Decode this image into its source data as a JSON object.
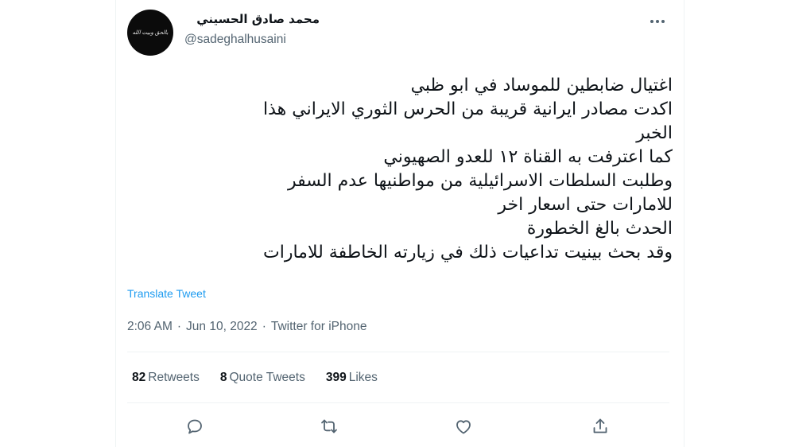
{
  "author": {
    "display_name": "محمد صادق الحسيني",
    "handle": "@sadeghalhusaini",
    "avatar_text": "بالحق وبيت الله"
  },
  "tweet": {
    "lines": [
      "اغتيال ضابطين للموساد في ابو ظبي",
      "اكدت مصادر ايرانية قريبة من الحرس الثوري الايراني هذا",
      "الخبر",
      "كما اعترفت به القناة ١٢ للعدو الصهيوني",
      "وطلبت السلطات الاسرائيلية من مواطنيها عدم السفر",
      "للامارات حتى اسعار اخر",
      "الحدث بالغ الخطورة",
      "وقد بحث بينيت تداعيات ذلك في زيارته الخاطفة للامارات"
    ],
    "translate_label": "Translate Tweet"
  },
  "meta": {
    "time": "2:06 AM",
    "separator": "·",
    "date": "Jun 10, 2022",
    "source": "Twitter for iPhone"
  },
  "stats": {
    "retweets_count": "82",
    "retweets_label": "Retweets",
    "quotes_count": "8",
    "quotes_label": "Quote Tweets",
    "likes_count": "399",
    "likes_label": "Likes"
  },
  "icons": {
    "more": "more-horizontal-icon",
    "reply": "reply-icon",
    "retweet": "retweet-icon",
    "like": "heart-icon",
    "share": "share-icon"
  },
  "colors": {
    "link": "#1d9bf0",
    "secondary_text": "#536471",
    "primary_text": "#0f1419",
    "divider": "#eff3f4"
  }
}
